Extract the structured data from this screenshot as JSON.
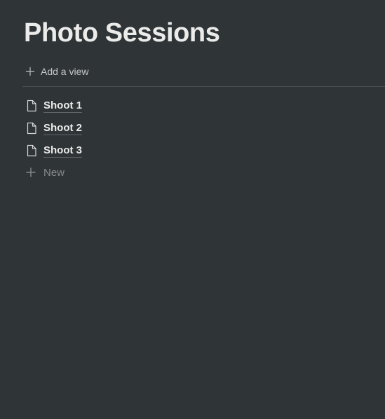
{
  "page": {
    "title": "Photo Sessions"
  },
  "view_bar": {
    "add_view_label": "Add a view",
    "add_view_icon": "plus-icon"
  },
  "list": {
    "items": [
      {
        "label": "Shoot 1",
        "icon": "page-icon"
      },
      {
        "label": "Shoot 2",
        "icon": "page-icon"
      },
      {
        "label": "Shoot 3",
        "icon": "page-icon"
      }
    ],
    "new_label": "New",
    "new_icon": "plus-icon"
  },
  "colors": {
    "background": "#2f3437",
    "text": "#ebebea"
  }
}
